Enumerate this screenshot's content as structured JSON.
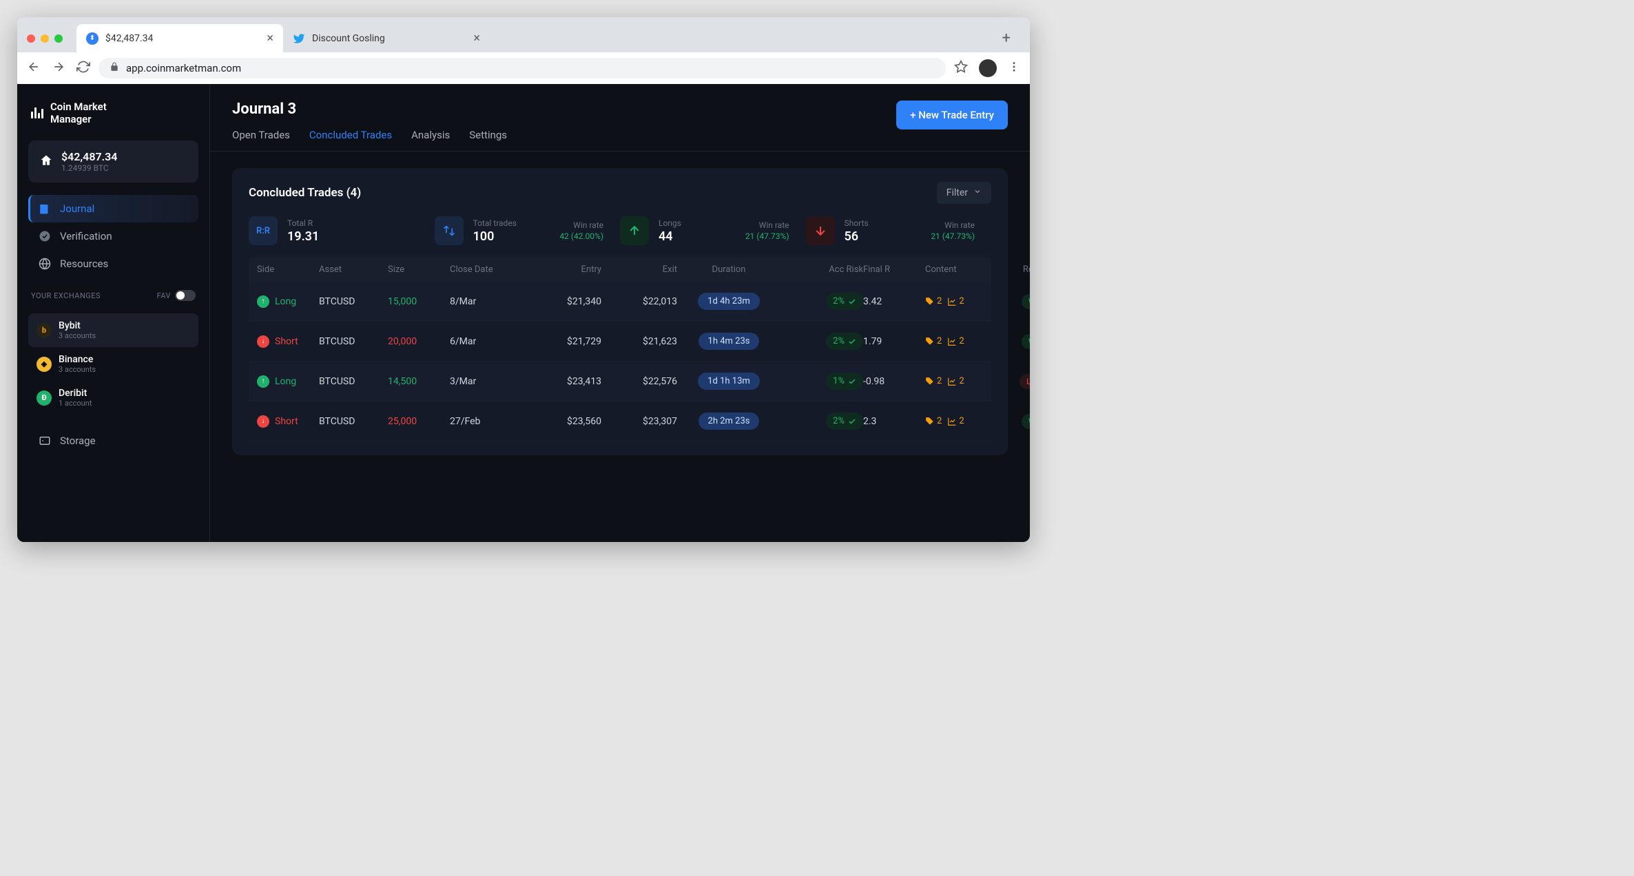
{
  "browser": {
    "tabs": [
      {
        "title": "$42,487.34",
        "active": true,
        "favicon": "app"
      },
      {
        "title": "Discount Gosling",
        "active": false,
        "favicon": "twitter"
      }
    ],
    "url": "app.coinmarketman.com"
  },
  "sidebar": {
    "app_name_line1": "Coin Market",
    "app_name_line2": "Manager",
    "balance_usd": "$42,487.34",
    "balance_btc": "1.24939 BTC",
    "nav": [
      {
        "label": "Journal",
        "active": true,
        "icon": "journal"
      },
      {
        "label": "Verification",
        "active": false,
        "icon": "check"
      },
      {
        "label": "Resources",
        "active": false,
        "icon": "globe"
      }
    ],
    "exchanges_label": "YOUR EXCHANGES",
    "fav_label": "FAV",
    "exchanges": [
      {
        "name": "Bybit",
        "sub": "3 accounts",
        "active": true,
        "kind": "bybit"
      },
      {
        "name": "Binance",
        "sub": "3 accounts",
        "active": false,
        "kind": "binance"
      },
      {
        "name": "Deribit",
        "sub": "1 account",
        "active": false,
        "kind": "deribit"
      }
    ],
    "storage_label": "Storage"
  },
  "header": {
    "title": "Journal 3",
    "tabs": [
      {
        "label": "Open Trades",
        "active": false
      },
      {
        "label": "Concluded Trades",
        "active": true
      },
      {
        "label": "Analysis",
        "active": false
      },
      {
        "label": "Settings",
        "active": false
      }
    ],
    "new_trade_label": "+ New Trade Entry"
  },
  "panel": {
    "title": "Concluded Trades (4)",
    "filter_label": "Filter",
    "stats": {
      "total_r": {
        "label": "Total R",
        "value": "19.31"
      },
      "total_trades": {
        "label": "Total trades",
        "value": "100",
        "sub_label": "Win rate",
        "sub_value": "42 (42.00%)"
      },
      "longs": {
        "label": "Longs",
        "value": "44",
        "sub_label": "Win rate",
        "sub_value": "21 (47.73%)"
      },
      "shorts": {
        "label": "Shorts",
        "value": "56",
        "sub_label": "Win rate",
        "sub_value": "21 (47.73%)"
      }
    },
    "columns": [
      "Side",
      "Asset",
      "Size",
      "Close Date",
      "Entry",
      "Exit",
      "Duration",
      "Acc Risk",
      "Final R",
      "Content",
      "Result"
    ],
    "rows": [
      {
        "side": "Long",
        "dir": "up",
        "asset": "BTCUSD",
        "size": "15,000",
        "close_date": "8/Mar",
        "entry": "$21,340",
        "exit": "$22,013",
        "duration": "1d 4h 23m",
        "risk": "2%",
        "final_r": "3.42",
        "tags": "2",
        "charts": "2",
        "result": "Win"
      },
      {
        "side": "Short",
        "dir": "down",
        "asset": "BTCUSD",
        "size": "20,000",
        "close_date": "6/Mar",
        "entry": "$21,729",
        "exit": "$21,623",
        "duration": "1h 4m 23s",
        "risk": "2%",
        "final_r": "1.79",
        "tags": "2",
        "charts": "2",
        "result": "Win"
      },
      {
        "side": "Long",
        "dir": "up",
        "asset": "BTCUSD",
        "size": "14,500",
        "close_date": "3/Mar",
        "entry": "$23,413",
        "exit": "$22,576",
        "duration": "1d 1h 13m",
        "risk": "1%",
        "final_r": "-0.98",
        "tags": "2",
        "charts": "2",
        "result": "Lose"
      },
      {
        "side": "Short",
        "dir": "down",
        "asset": "BTCUSD",
        "size": "25,000",
        "close_date": "27/Feb",
        "entry": "$23,560",
        "exit": "$23,307",
        "duration": "2h 2m 23s",
        "risk": "2%",
        "final_r": "2.3",
        "tags": "2",
        "charts": "2",
        "result": "Win"
      }
    ]
  }
}
